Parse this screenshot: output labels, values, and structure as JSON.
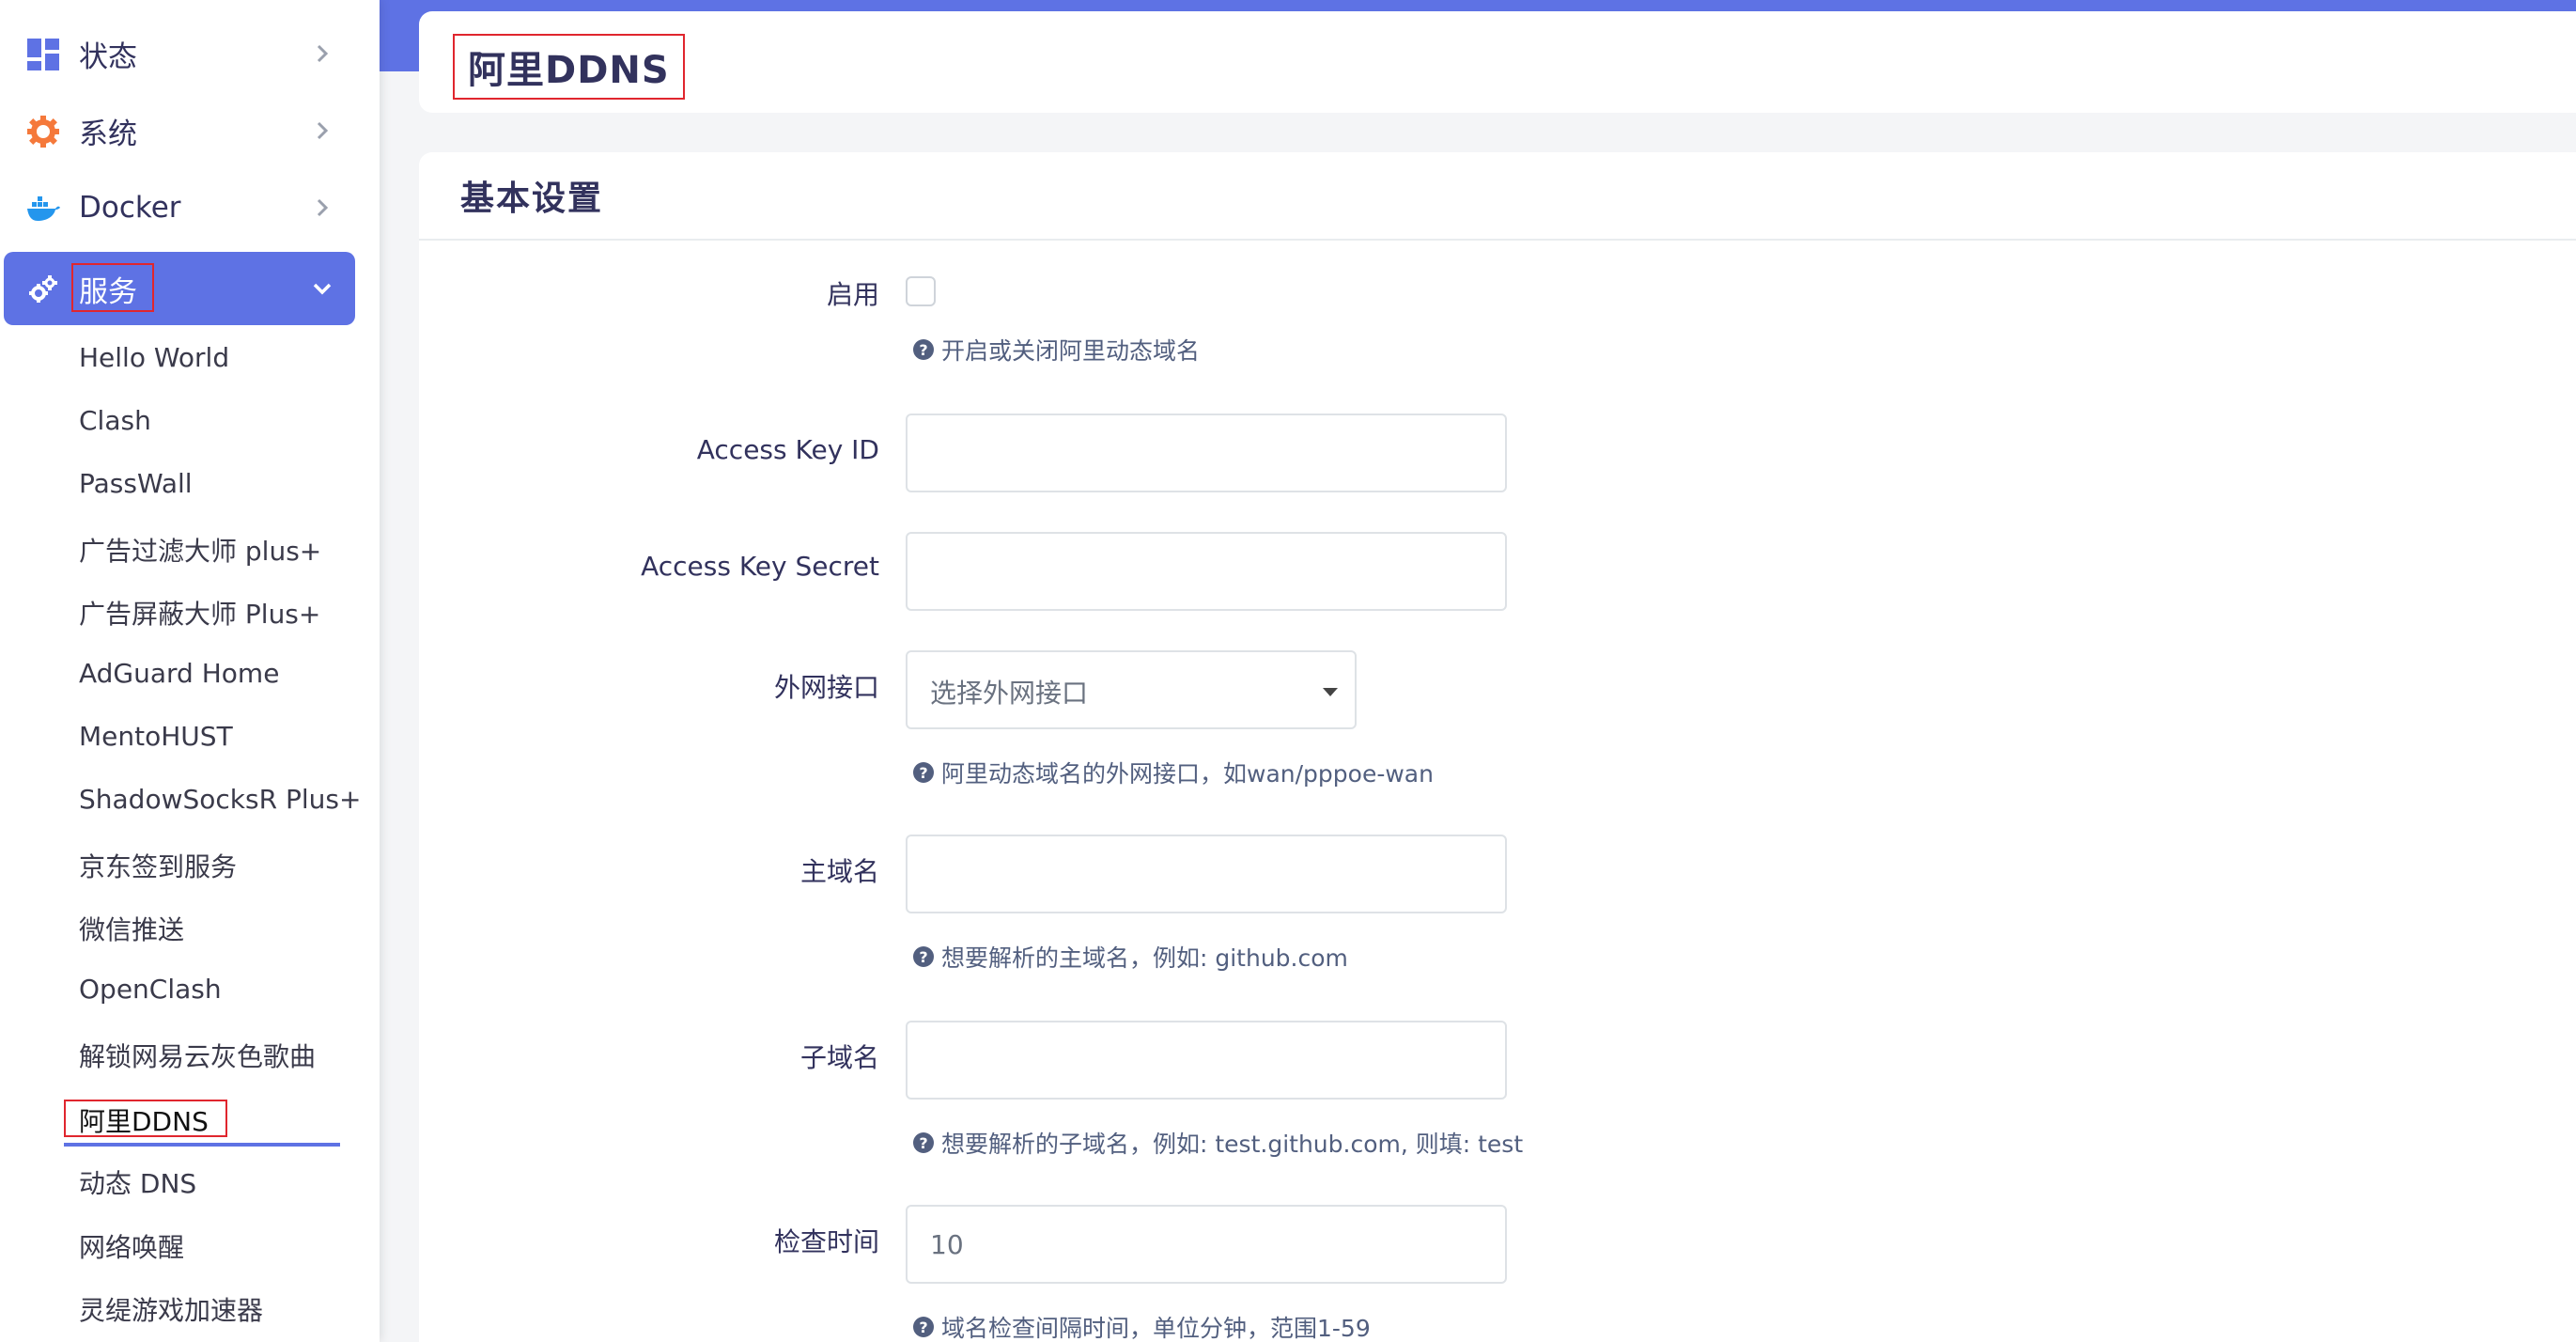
{
  "sidebar": {
    "menus": [
      {
        "label": "状态",
        "icon": "dashboard-icon"
      },
      {
        "label": "系统",
        "icon": "gear-icon"
      },
      {
        "label": "Docker",
        "icon": "docker-icon"
      },
      {
        "label": "服务",
        "icon": "services-gears-icon",
        "active": true
      }
    ],
    "services": [
      "Hello World",
      "Clash",
      "PassWall",
      "广告过滤大师 plus+",
      "广告屏蔽大师 Plus+",
      "AdGuard Home",
      "MentoHUST",
      "ShadowSocksR Plus+",
      "京东签到服务",
      "微信推送",
      "OpenClash",
      "解锁网易云灰色歌曲",
      "阿里DDNS",
      "动态 DNS",
      "网络唤醒",
      "灵缇游戏加速器"
    ]
  },
  "page": {
    "title": "阿里DDNS",
    "section_title": "基本设置"
  },
  "form": {
    "enable": {
      "label": "启用",
      "checked": false,
      "help": "开启或关闭阿里动态域名"
    },
    "access_key_id": {
      "label": "Access Key ID",
      "value": ""
    },
    "access_key_secret": {
      "label": "Access Key Secret",
      "value": ""
    },
    "wan_interface": {
      "label": "外网接口",
      "placeholder": "选择外网接口",
      "help": "阿里动态域名的外网接口，如wan/pppoe-wan"
    },
    "main_domain": {
      "label": "主域名",
      "value": "",
      "help": "想要解析的主域名，例如: github.com"
    },
    "sub_domain": {
      "label": "子域名",
      "value": "",
      "help": "想要解析的子域名，例如: test.github.com, 则填: test"
    },
    "check_time": {
      "label": "检查时间",
      "placeholder": "10",
      "help": "域名检查间隔时间，单位分钟，范围1-59"
    }
  },
  "colors": {
    "accent": "#5e72e4",
    "highlight_box": "#e0262e",
    "gear_orange": "#f5793b",
    "docker_blue": "#2496ed"
  }
}
